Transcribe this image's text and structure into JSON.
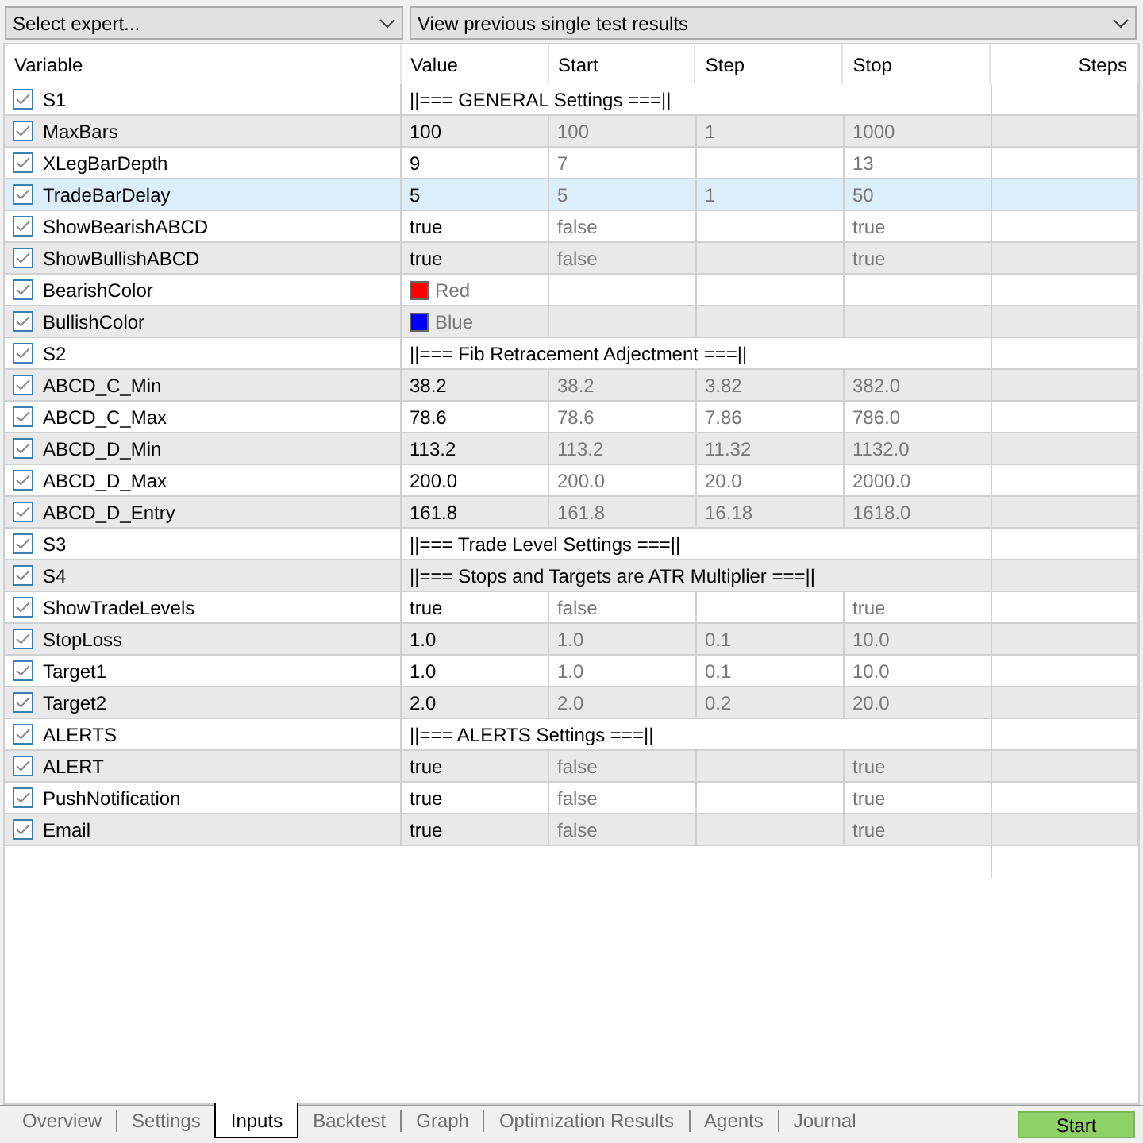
{
  "toolbar": {
    "expert_select": "Select expert...",
    "results_select": "View previous single test results"
  },
  "table": {
    "columns": [
      "Variable",
      "Value",
      "Start",
      "Step",
      "Stop",
      "Steps"
    ],
    "rows": [
      {
        "kind": "section",
        "name": "S1",
        "checked": true,
        "selected": false,
        "value": "||=== GENERAL Settings ===||"
      },
      {
        "kind": "param",
        "name": "MaxBars",
        "checked": true,
        "selected": false,
        "value": "100",
        "start": "100",
        "step": "1",
        "stop": "1000"
      },
      {
        "kind": "param",
        "name": "XLegBarDepth",
        "checked": true,
        "selected": false,
        "value": "9",
        "start": "7",
        "stop": "13"
      },
      {
        "kind": "param",
        "name": "TradeBarDelay",
        "checked": true,
        "selected": true,
        "value": "5",
        "start": "5",
        "step": "1",
        "stop": "50"
      },
      {
        "kind": "param",
        "name": "ShowBearishABCD",
        "checked": true,
        "selected": false,
        "value": "true",
        "start": "false",
        "stop": "true"
      },
      {
        "kind": "param",
        "name": "ShowBullishABCD",
        "checked": true,
        "selected": false,
        "value": "true",
        "start": "false",
        "stop": "true"
      },
      {
        "kind": "color",
        "name": "BearishColor",
        "checked": true,
        "selected": false,
        "value": "Red",
        "color": "#ff0000"
      },
      {
        "kind": "color",
        "name": "BullishColor",
        "checked": true,
        "selected": false,
        "value": "Blue",
        "color": "#0000ff"
      },
      {
        "kind": "section",
        "name": "S2",
        "checked": true,
        "selected": false,
        "value": "||=== Fib Retracement Adjectment ===||"
      },
      {
        "kind": "param",
        "name": "ABCD_C_Min",
        "checked": true,
        "selected": false,
        "value": "38.2",
        "start": "38.2",
        "step": "3.82",
        "stop": "382.0"
      },
      {
        "kind": "param",
        "name": "ABCD_C_Max",
        "checked": true,
        "selected": false,
        "value": "78.6",
        "start": "78.6",
        "step": "7.86",
        "stop": "786.0"
      },
      {
        "kind": "param",
        "name": "ABCD_D_Min",
        "checked": true,
        "selected": false,
        "value": "113.2",
        "start": "113.2",
        "step": "11.32",
        "stop": "1132.0"
      },
      {
        "kind": "param",
        "name": "ABCD_D_Max",
        "checked": true,
        "selected": false,
        "value": "200.0",
        "start": "200.0",
        "step": "20.0",
        "stop": "2000.0"
      },
      {
        "kind": "param",
        "name": "ABCD_D_Entry",
        "checked": true,
        "selected": false,
        "value": "161.8",
        "start": "161.8",
        "step": "16.18",
        "stop": "1618.0"
      },
      {
        "kind": "section",
        "name": "S3",
        "checked": true,
        "selected": false,
        "value": "||=== Trade Level Settings ===||"
      },
      {
        "kind": "section",
        "name": "S4",
        "checked": true,
        "selected": false,
        "value": "||=== Stops and Targets are ATR Multiplier ===||"
      },
      {
        "kind": "param",
        "name": "ShowTradeLevels",
        "checked": true,
        "selected": false,
        "value": "true",
        "start": "false",
        "stop": "true"
      },
      {
        "kind": "param",
        "name": "StopLoss",
        "checked": true,
        "selected": false,
        "value": "1.0",
        "start": "1.0",
        "step": "0.1",
        "stop": "10.0"
      },
      {
        "kind": "param",
        "name": "Target1",
        "checked": true,
        "selected": false,
        "value": "1.0",
        "start": "1.0",
        "step": "0.1",
        "stop": "10.0"
      },
      {
        "kind": "param",
        "name": "Target2",
        "checked": true,
        "selected": false,
        "value": "2.0",
        "start": "2.0",
        "step": "0.2",
        "stop": "20.0"
      },
      {
        "kind": "section",
        "name": "ALERTS",
        "checked": true,
        "selected": false,
        "value": "||=== ALERTS Settings ===||"
      },
      {
        "kind": "param",
        "name": "ALERT",
        "checked": true,
        "selected": false,
        "value": "true",
        "start": "false",
        "stop": "true"
      },
      {
        "kind": "param",
        "name": "PushNotification",
        "checked": true,
        "selected": false,
        "value": "true",
        "start": "false",
        "stop": "true"
      },
      {
        "kind": "param",
        "name": "Email",
        "checked": true,
        "selected": false,
        "value": "true",
        "start": "false",
        "stop": "true"
      }
    ]
  },
  "tabs": [
    {
      "label": "Overview",
      "selected": false
    },
    {
      "label": "Settings",
      "selected": false
    },
    {
      "label": "Inputs",
      "selected": true
    },
    {
      "label": "Backtest",
      "selected": false
    },
    {
      "label": "Graph",
      "selected": false
    },
    {
      "label": "Optimization Results",
      "selected": false
    },
    {
      "label": "Agents",
      "selected": false
    },
    {
      "label": "Journal",
      "selected": false
    }
  ],
  "start_button": "Start"
}
